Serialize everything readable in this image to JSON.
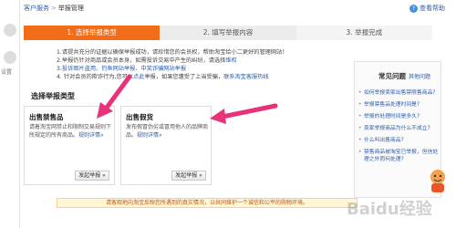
{
  "breadcrumb": {
    "home": "客户服务",
    "sep": ">",
    "current": "举报管理"
  },
  "help": {
    "label": "查看帮助",
    "icon": "help-icon"
  },
  "left_rail": {
    "label": "设置"
  },
  "steps": [
    {
      "label": "1. 选择举报类型",
      "active": true
    },
    {
      "label": "2. 填写举报内容",
      "active": false
    },
    {
      "label": "3. 举报完成",
      "active": false
    }
  ],
  "notes": {
    "line1": "1.请提共充分的证据以确保举报成功，请珍惜您的会员权，帮助淘宝给小二更好的管理网站！",
    "line2a": "2.举报仍针对商品或会员本身，如需投诉交易中产生的纠纷，请选择",
    "line2b": "维权",
    "line3a": "3.",
    "line3b": "投诉图片盗用、钓鱼网站举报、中奖诈骗网站举报",
    "line4a": "4. 针对会员的欺诈行为,您可以",
    "line4b": "点此",
    "line4c": "举报，如果您遭受了上当受骗，",
    "line4d": "联系淘宝客服热线"
  },
  "section_title": "选择举报类型",
  "cards": [
    {
      "title": "出售禁售品",
      "desc": "请着淘宝网禁止和限制交易规则下所规定的所有商品。",
      "link": "规则详情»",
      "button": "发起举报 »"
    },
    {
      "title": "出售假货",
      "desc": "发布假冒伪劣或冒用他人的品牌商品。",
      "link": "规则详情»",
      "button": "发起举报 »"
    }
  ],
  "warning": "请客观地向淘宝反映您所遇到的真实情况，以共同维护一个诚信和公平的购物环境。",
  "faq": {
    "title": "常见问题",
    "more": "其他问题",
    "items": [
      "如何举报卖家出售禁限售商品?",
      "举报禁售品处理时间是?",
      "举报的处理时间是多久?",
      "卖家举报商品为什么不成立?",
      "什么叫出售商品?",
      "禁售商品被淘宝已举报，但信处理之外而何处理?"
    ]
  },
  "watermark": "Baidu经验",
  "colors": {
    "accent": "#f36c1a",
    "link": "#2b5cad",
    "arrow": "#e8327a"
  }
}
